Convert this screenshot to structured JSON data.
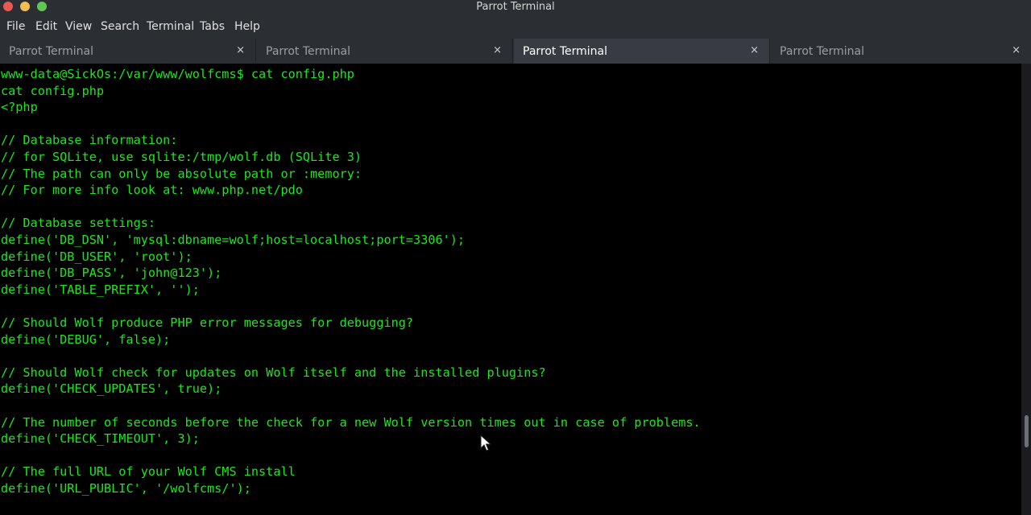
{
  "window": {
    "title": "Parrot Terminal",
    "controls": {
      "close_color": "#e85a4f",
      "minimize_color": "#f5bf4f",
      "maximize_color": "#62c655"
    }
  },
  "menubar": {
    "items": [
      {
        "label": "File"
      },
      {
        "label": "Edit"
      },
      {
        "label": "View"
      },
      {
        "label": "Search"
      },
      {
        "label": "Terminal"
      },
      {
        "label": "Tabs"
      },
      {
        "label": "Help"
      }
    ]
  },
  "tabs": [
    {
      "label": "Parrot Terminal",
      "close": "×",
      "active": false
    },
    {
      "label": "Parrot Terminal",
      "close": "×",
      "active": false
    },
    {
      "label": "Parrot Terminal",
      "close": "×",
      "active": true
    },
    {
      "label": "Parrot Terminal",
      "close": "×",
      "active": false
    }
  ],
  "terminal": {
    "text_color": "#1fe51f",
    "lines": [
      "www-data@SickOs:/var/www/wolfcms$ cat config.php",
      "cat config.php",
      "<?php",
      "",
      "// Database information:",
      "// for SQLite, use sqlite:/tmp/wolf.db (SQLite 3)",
      "// The path can only be absolute path or :memory:",
      "// For more info look at: www.php.net/pdo",
      "",
      "// Database settings:",
      "define('DB_DSN', 'mysql:dbname=wolf;host=localhost;port=3306');",
      "define('DB_USER', 'root');",
      "define('DB_PASS', 'john@123');",
      "define('TABLE_PREFIX', '');",
      "",
      "// Should Wolf produce PHP error messages for debugging?",
      "define('DEBUG', false);",
      "",
      "// Should Wolf check for updates on Wolf itself and the installed plugins?",
      "define('CHECK_UPDATES', true);",
      "",
      "// The number of seconds before the check for a new Wolf version times out in case of problems.",
      "define('CHECK_TIMEOUT', 3);",
      "",
      "// The full URL of your Wolf CMS install",
      "define('URL_PUBLIC', '/wolfcms/');"
    ]
  }
}
